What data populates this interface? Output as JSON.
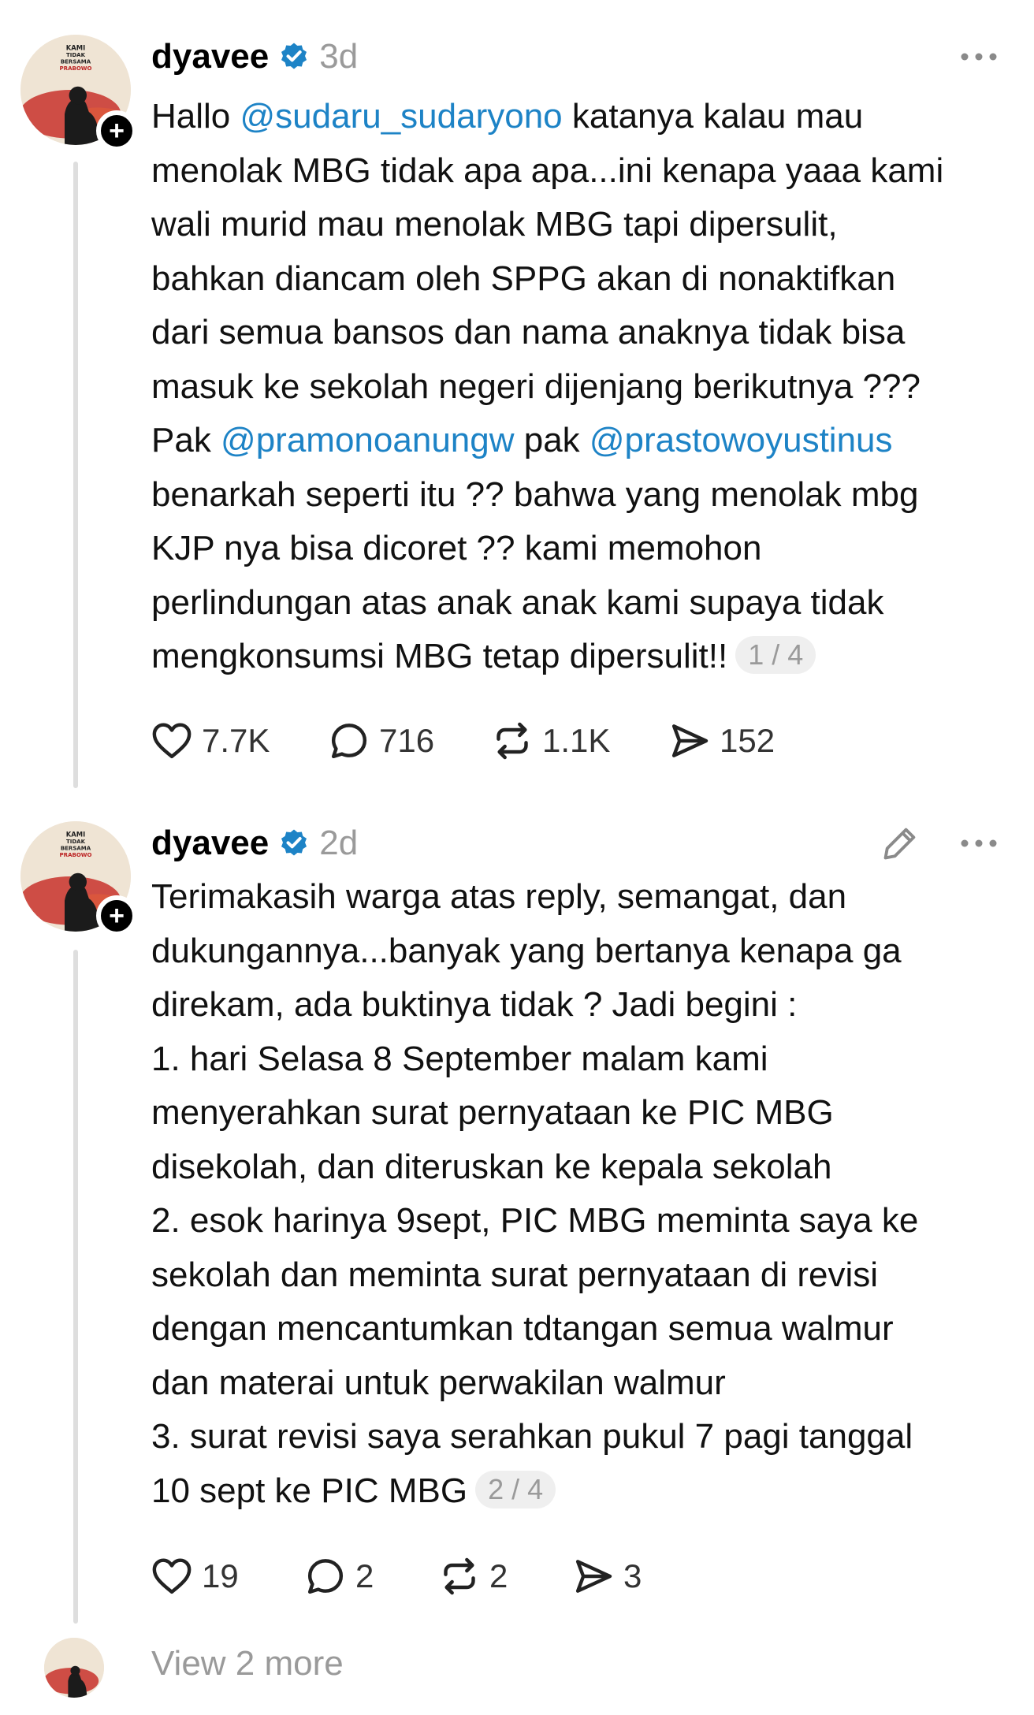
{
  "colors": {
    "mention": "#1d83c6",
    "verified": "#1d83c6",
    "muted": "#9a9a9a",
    "thread_line": "#dedede"
  },
  "avatar": {
    "poster_lines": [
      "KAMI",
      "TIDAK",
      "BERSAMA",
      "PRABOWO"
    ],
    "icon": "profile-poster-avatar"
  },
  "posts": [
    {
      "username": "dyavee",
      "timestamp": "3d",
      "lines": [
        {
          "parts": [
            {
              "t": "Hallo "
            },
            {
              "t": "@sudaru_sudaryono",
              "m": true
            },
            {
              "t": "  katanya kalau mau"
            }
          ]
        },
        {
          "parts": [
            {
              "t": "menolak MBG tidak apa apa...ini kenapa yaaa kami"
            }
          ]
        },
        {
          "parts": [
            {
              "t": "wali murid mau menolak MBG tapi dipersulit,"
            }
          ]
        },
        {
          "parts": [
            {
              "t": "bahkan diancam oleh SPPG akan di nonaktifkan"
            }
          ]
        },
        {
          "parts": [
            {
              "t": "dari semua bansos dan nama anaknya tidak bisa"
            }
          ]
        },
        {
          "parts": [
            {
              "t": "masuk ke sekolah negeri dijenjang berikutnya ???"
            }
          ]
        },
        {
          "parts": [
            {
              "t": "Pak "
            },
            {
              "t": "@pramonoanungw",
              "m": true
            },
            {
              "t": "  pak "
            },
            {
              "t": "@prastowoyustinus",
              "m": true
            }
          ]
        },
        {
          "parts": [
            {
              "t": "benarkah seperti itu ?? bahwa yang menolak mbg"
            }
          ]
        },
        {
          "parts": [
            {
              "t": "KJP nya bisa dicoret ?? kami memohon"
            }
          ]
        },
        {
          "parts": [
            {
              "t": "perlindungan atas anak anak kami supaya tidak"
            }
          ]
        },
        {
          "parts": [
            {
              "t": "mengkonsumsi MBG tetap dipersulit!!"
            }
          ]
        }
      ],
      "page_indicator": "1 / 4",
      "stats": {
        "likes": "7.7K",
        "replies": "716",
        "reposts": "1.1K",
        "shares": "152"
      }
    },
    {
      "username": "dyavee",
      "timestamp": "2d",
      "lines": [
        {
          "parts": [
            {
              "t": "Terimakasih warga atas reply, semangat, dan"
            }
          ]
        },
        {
          "parts": [
            {
              "t": "dukungannya...banyak yang bertanya kenapa ga"
            }
          ]
        },
        {
          "parts": [
            {
              "t": "direkam, ada buktinya tidak ? Jadi begini :"
            }
          ]
        },
        {
          "parts": [
            {
              "t": "1. hari Selasa 8 September malam kami"
            }
          ]
        },
        {
          "parts": [
            {
              "t": "menyerahkan surat pernyataan ke PIC MBG"
            }
          ]
        },
        {
          "parts": [
            {
              "t": "disekolah, dan diteruskan ke kepala sekolah"
            }
          ]
        },
        {
          "parts": [
            {
              "t": "2. esok harinya 9sept, PIC MBG meminta saya ke"
            }
          ]
        },
        {
          "parts": [
            {
              "t": "sekolah dan meminta surat pernyataan di revisi"
            }
          ]
        },
        {
          "parts": [
            {
              "t": "dengan mencantumkan tdtangan semua walmur"
            }
          ]
        },
        {
          "parts": [
            {
              "t": "dan materai untuk perwakilan walmur"
            }
          ]
        },
        {
          "parts": [
            {
              "t": "3. surat revisi saya serahkan pukul 7 pagi tanggal"
            }
          ]
        },
        {
          "parts": [
            {
              "t": "10 sept ke PIC MBG"
            }
          ]
        }
      ],
      "page_indicator": "2 / 4",
      "stats": {
        "likes": "19",
        "replies": "2",
        "reposts": "2",
        "shares": "3"
      }
    }
  ],
  "view_more_label": "View 2 more"
}
